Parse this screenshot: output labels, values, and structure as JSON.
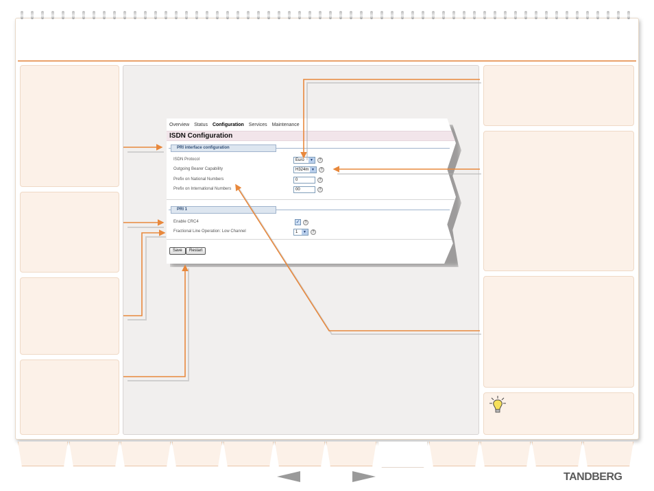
{
  "nav": {
    "items": [
      "Overview",
      "Status",
      "Configuration",
      "Services",
      "Maintenance"
    ],
    "active_index": 2
  },
  "page_title": "ISDN Configuration",
  "pri_interface": {
    "legend": "PRI interface configuration",
    "isdn_protocol": {
      "label": "ISDN Protocol",
      "value": "Euro"
    },
    "outgoing_bearer": {
      "label": "Outgoing Bearer Capability",
      "value": "H324m"
    },
    "prefix_national": {
      "label": "Prefix on National Numbers",
      "value": "0"
    },
    "prefix_international": {
      "label": "Prefix on International Numbers",
      "value": "00"
    }
  },
  "pri1": {
    "legend": "PRI 1",
    "enable_crc4": {
      "label": "Enable CRC4",
      "checked": true
    },
    "fractional_low": {
      "label": "Fractional Line Operation: Low Channel",
      "value": "1"
    }
  },
  "buttons": {
    "save": "Save",
    "restart": "Restart"
  },
  "help_glyph": "?",
  "check_glyph": "✓",
  "dropdown_glyph": "▼",
  "brand": {
    "logo": "TANDBERG"
  },
  "colors": {
    "accent": "#e8883c",
    "panel": "#fcf1e8"
  }
}
